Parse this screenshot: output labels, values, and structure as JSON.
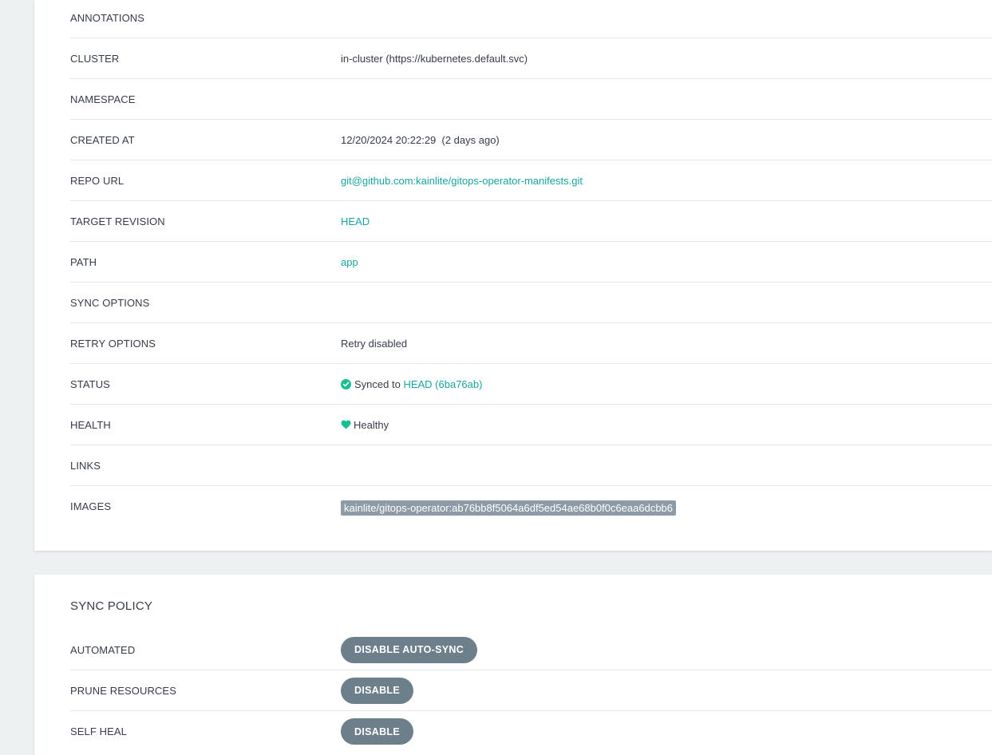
{
  "summary": {
    "rows": [
      {
        "label": "ANNOTATIONS",
        "value": ""
      },
      {
        "label": "CLUSTER",
        "value": "in-cluster (https://kubernetes.default.svc)"
      },
      {
        "label": "NAMESPACE",
        "value": ""
      },
      {
        "label": "CREATED AT",
        "value": "12/20/2024 20:22:29  (2 days ago)"
      },
      {
        "label": "REPO URL",
        "value": "git@github.com:kainlite/gitops-operator-manifests.git"
      },
      {
        "label": "TARGET REVISION",
        "value": "HEAD"
      },
      {
        "label": "PATH",
        "value": "app"
      },
      {
        "label": "SYNC OPTIONS",
        "value": ""
      },
      {
        "label": "RETRY OPTIONS",
        "value": "Retry disabled"
      },
      {
        "label": "STATUS",
        "value_prefix": "Synced to",
        "value_link": "HEAD (6ba76ab)"
      },
      {
        "label": "HEALTH",
        "value": "Healthy"
      },
      {
        "label": "LINKS",
        "value": ""
      },
      {
        "label": "IMAGES",
        "value": "kainlite/gitops-operator:ab76bb8f5064a6df5ed54ae68b0f0c6eaa6dcbb6"
      }
    ],
    "icons": {
      "status": "check-circle-icon",
      "health": "heart-icon"
    },
    "colors": {
      "synced": "#18be94",
      "link": "#18a5a1",
      "image_tag_bg": "#8c9ba5"
    }
  },
  "sync_policy": {
    "title": "SYNC POLICY",
    "rows": [
      {
        "label": "AUTOMATED",
        "button": "DISABLE AUTO-SYNC"
      },
      {
        "label": "PRUNE RESOURCES",
        "button": "DISABLE"
      },
      {
        "label": "SELF HEAL",
        "button": "DISABLE"
      }
    ],
    "colors": {
      "button_bg": "#6d7f8b"
    }
  }
}
